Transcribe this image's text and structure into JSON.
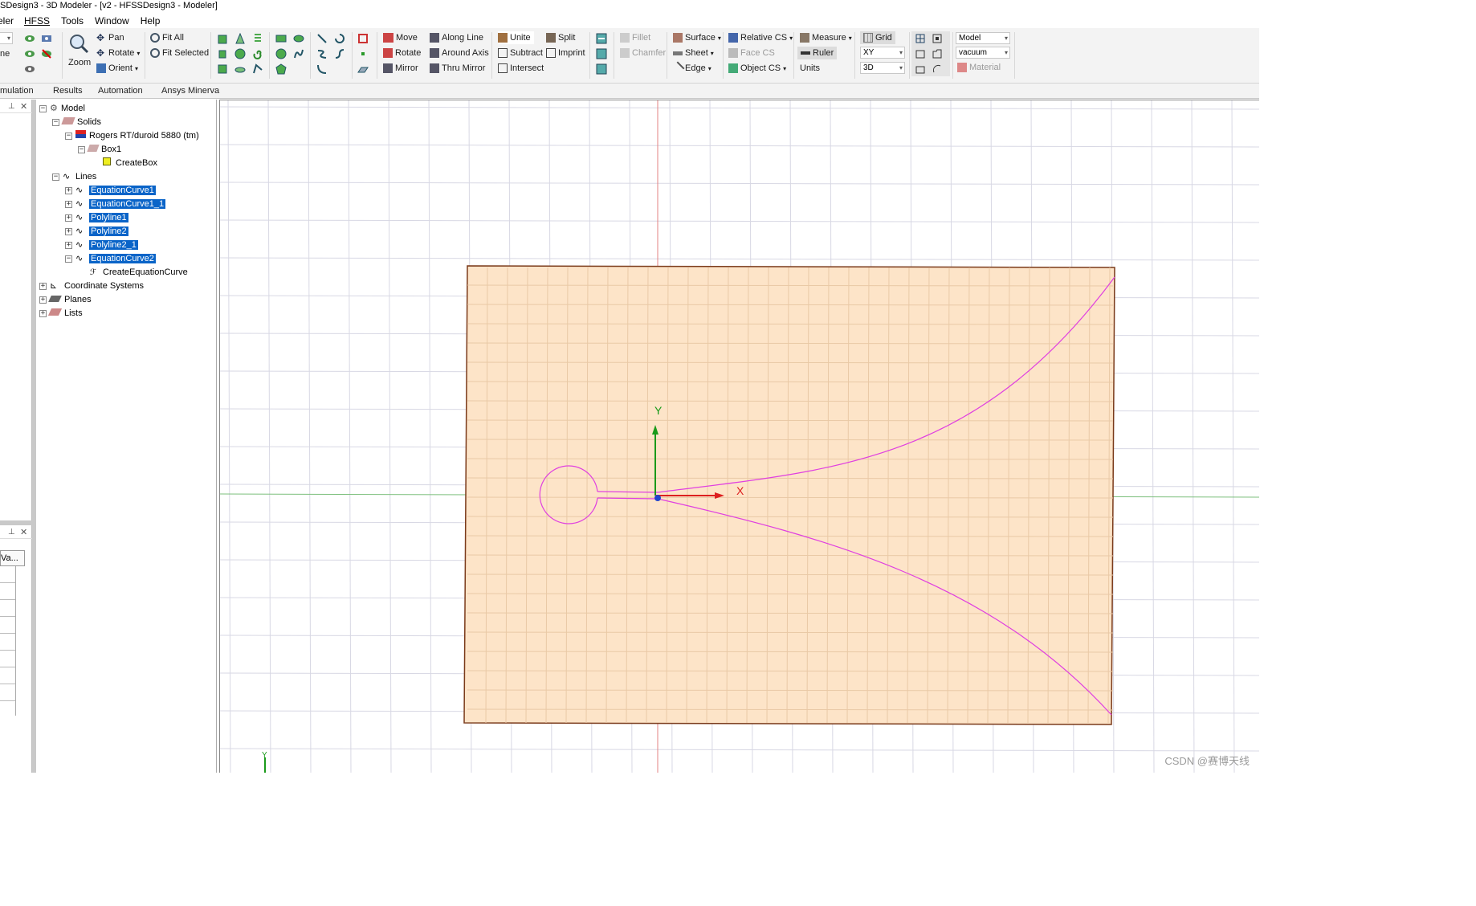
{
  "window": {
    "title": "SDesign3 - 3D Modeler - [v2 - HFSSDesign3 - Modeler]"
  },
  "menu": [
    "eler",
    "HFSS",
    "Tools",
    "Window",
    "Help"
  ],
  "ribbon": {
    "view": {
      "pan": "Pan",
      "rotate": "Rotate",
      "orient": "Orient",
      "zoom": "Zoom",
      "fit_all": "Fit All",
      "fit_selected": "Fit Selected",
      "left_label": "ne"
    },
    "transform": {
      "move": "Move",
      "rotate": "Rotate",
      "mirror": "Mirror",
      "along_line": "Along Line",
      "around_axis": "Around Axis",
      "thru_mirror": "Thru Mirror"
    },
    "boolean": {
      "unite": "Unite",
      "subtract": "Subtract",
      "intersect": "Intersect",
      "split": "Split",
      "imprint": "Imprint"
    },
    "edit": {
      "fillet": "Fillet",
      "chamfer": "Chamfer"
    },
    "select": {
      "surface": "Surface",
      "sheet": "Sheet",
      "edge": "Edge"
    },
    "cs": {
      "relative_cs": "Relative CS",
      "face_cs": "Face CS",
      "object_cs": "Object CS"
    },
    "measure": {
      "measure": "Measure",
      "ruler": "Ruler",
      "units": "Units"
    },
    "grid": {
      "grid": "Grid",
      "plane": "XY",
      "mode": "3D"
    },
    "material": {
      "model": "Model",
      "material_value": "vacuum",
      "material": "Material"
    }
  },
  "ribbon_tabs": [
    "mulation",
    "Results",
    "Automation",
    "Ansys Minerva"
  ],
  "panel": {
    "value_header": "Va..."
  },
  "tree": {
    "model": "Model",
    "solids": "Solids",
    "material": "Rogers RT/duroid 5880 (tm)",
    "box": "Box1",
    "create_box": "CreateBox",
    "lines": "Lines",
    "items": [
      "EquationCurve1",
      "EquationCurve1_1",
      "Polyline1",
      "Polyline2",
      "Polyline2_1",
      "EquationCurve2"
    ],
    "create_eq": "CreateEquationCurve",
    "coord": "Coordinate Systems",
    "planes": "Planes",
    "lists": "Lists"
  },
  "viewport": {
    "axis_x": "X",
    "axis_y": "Y",
    "mini_y": "Y",
    "substrate_color": "#fde4c8",
    "curve_color": "#e040e0"
  },
  "watermark": "CSDN @赛博天线"
}
